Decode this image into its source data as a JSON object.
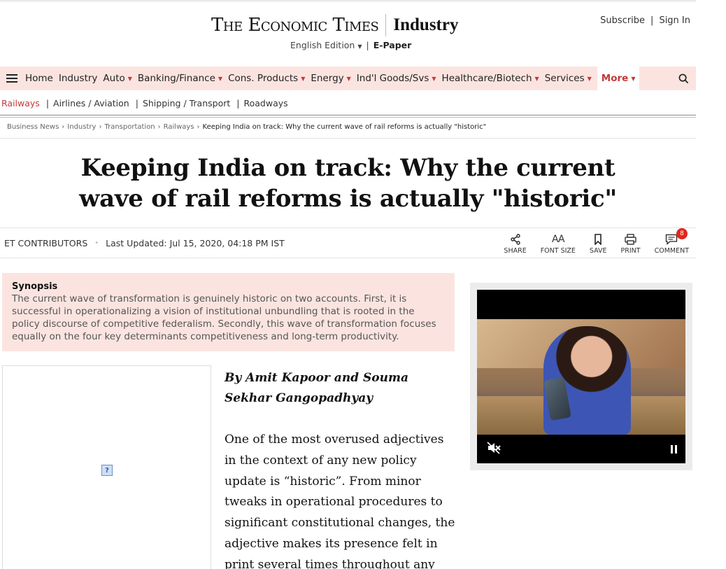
{
  "masthead": {
    "logo": "The Economic Times",
    "section": "Industry",
    "edition": "English Edition",
    "epaper": "E-Paper",
    "subscribe": "Subscribe",
    "sign_in": "Sign In",
    "separator": "|"
  },
  "nav": {
    "items": [
      {
        "label": "Home",
        "dropdown": false
      },
      {
        "label": "Industry",
        "dropdown": false
      },
      {
        "label": "Auto",
        "dropdown": true
      },
      {
        "label": "Banking/Finance",
        "dropdown": true
      },
      {
        "label": "Cons. Products",
        "dropdown": true
      },
      {
        "label": "Energy",
        "dropdown": true
      },
      {
        "label": "Ind'l Goods/Svs",
        "dropdown": true
      },
      {
        "label": "Healthcare/Biotech",
        "dropdown": true
      },
      {
        "label": "Services",
        "dropdown": true
      }
    ],
    "more": "More",
    "accent_color": "#c4383a",
    "bar_color": "#fbe4e0"
  },
  "subnav": {
    "items": [
      "Railways",
      "Airlines / Aviation",
      "Shipping / Transport",
      "Roadways"
    ],
    "separator": "|"
  },
  "breadcrumb": {
    "items": [
      "Business News",
      "Industry",
      "Transportation",
      "Railways"
    ],
    "separator": "›",
    "current": "Keeping India on track: Why the current wave of rail reforms is actually \"historic\""
  },
  "article": {
    "headline": "Keeping India on track: Why the current wave of rail reforms is actually \"historic\"",
    "contributors": "ET CONTRIBUTORS",
    "dot": "•",
    "last_updated": "Last Updated: Jul 15, 2020, 04:18 PM IST",
    "synopsis_title": "Synopsis",
    "synopsis_text": "The current wave of transformation is genuinely historic on two accounts. First, it is successful in operationalizing a vision of institutional unbundling that is rooted in the policy discourse of competitive federalism. Secondly, this wave of transformation focuses equally on the four key determinants competitiveness and long-term productivity.",
    "author": "By Amit Kapoor and Souma Sekhar Gangopadhyay",
    "body": "One of the most overused adjectives in the context of any new policy update is “historic”. From minor tweaks in operational procedures to significant constitutional changes, the adjective makes its presence felt in print several times throughout any typical week. The"
  },
  "tools": {
    "share": "SHARE",
    "font_size": "FONT SIZE",
    "font_icon": "AA",
    "save": "SAVE",
    "print": "PRINT",
    "comment": "COMMENT",
    "comment_count": "8"
  },
  "ad": {
    "icon_text": "?"
  }
}
